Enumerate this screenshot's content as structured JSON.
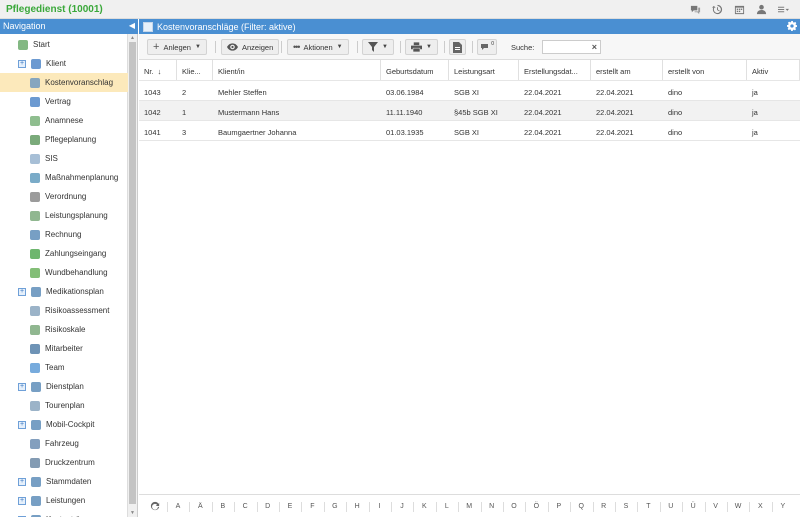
{
  "app": {
    "title": "Pflegedienst (10001)"
  },
  "top_icons": [
    "chat-icon",
    "history-icon",
    "calendar-icon",
    "user-icon",
    "menu-icon"
  ],
  "navigation": {
    "title": "Navigation",
    "items": [
      {
        "label": "Start",
        "icon": "home-icon",
        "expandable": false,
        "indent": 1,
        "selected": false
      },
      {
        "label": "Klient",
        "icon": "client-icon",
        "expandable": true,
        "indent": 1,
        "selected": false
      },
      {
        "label": "Kostenvoranschlag",
        "icon": "estimate-icon",
        "expandable": false,
        "indent": 2,
        "selected": true
      },
      {
        "label": "Vertrag",
        "icon": "contract-icon",
        "expandable": false,
        "indent": 2,
        "selected": false
      },
      {
        "label": "Anamnese",
        "icon": "anamnesis-icon",
        "expandable": false,
        "indent": 2,
        "selected": false
      },
      {
        "label": "Pflegeplanung",
        "icon": "care-plan-icon",
        "expandable": false,
        "indent": 2,
        "selected": false
      },
      {
        "label": "SIS",
        "icon": "sis-icon",
        "expandable": false,
        "indent": 2,
        "selected": false
      },
      {
        "label": "Maßnahmenplanung",
        "icon": "measures-icon",
        "expandable": false,
        "indent": 2,
        "selected": false
      },
      {
        "label": "Verordnung",
        "icon": "prescription-icon",
        "expandable": false,
        "indent": 2,
        "selected": false
      },
      {
        "label": "Leistungsplanung",
        "icon": "service-plan-icon",
        "expandable": false,
        "indent": 2,
        "selected": false
      },
      {
        "label": "Rechnung",
        "icon": "invoice-icon",
        "expandable": false,
        "indent": 2,
        "selected": false
      },
      {
        "label": "Zahlungseingang",
        "icon": "payment-icon",
        "expandable": false,
        "indent": 2,
        "selected": false
      },
      {
        "label": "Wundbehandlung",
        "icon": "wound-icon",
        "expandable": false,
        "indent": 2,
        "selected": false
      },
      {
        "label": "Medikationsplan",
        "icon": "medication-icon",
        "expandable": true,
        "indent": 1,
        "selected": false
      },
      {
        "label": "Risikoassessment",
        "icon": "risk-assessment-icon",
        "expandable": false,
        "indent": 2,
        "selected": false
      },
      {
        "label": "Risikoskale",
        "icon": "risk-scale-icon",
        "expandable": false,
        "indent": 2,
        "selected": false
      },
      {
        "label": "Mitarbeiter",
        "icon": "employee-icon",
        "expandable": false,
        "indent": 2,
        "selected": false
      },
      {
        "label": "Team",
        "icon": "team-icon",
        "expandable": false,
        "indent": 2,
        "selected": false
      },
      {
        "label": "Dienstplan",
        "icon": "duty-roster-icon",
        "expandable": true,
        "indent": 1,
        "selected": false
      },
      {
        "label": "Tourenplan",
        "icon": "route-plan-icon",
        "expandable": false,
        "indent": 2,
        "selected": false
      },
      {
        "label": "Mobil-Cockpit",
        "icon": "cloud-icon",
        "expandable": true,
        "indent": 1,
        "selected": false
      },
      {
        "label": "Fahrzeug",
        "icon": "car-icon",
        "expandable": false,
        "indent": 2,
        "selected": false
      },
      {
        "label": "Druckzentrum",
        "icon": "print-center-icon",
        "expandable": false,
        "indent": 2,
        "selected": false
      },
      {
        "label": "Stammdaten",
        "icon": "master-data-icon",
        "expandable": true,
        "indent": 1,
        "selected": false
      },
      {
        "label": "Leistungen",
        "icon": "services-icon",
        "expandable": true,
        "indent": 1,
        "selected": false
      },
      {
        "label": "Kostenträger",
        "icon": "payer-icon",
        "expandable": true,
        "indent": 1,
        "selected": false
      }
    ]
  },
  "main": {
    "title": "Kostenvoranschläge (Filter: aktive)",
    "toolbar": {
      "anlegen": "Anlegen",
      "anzeigen": "Anzeigen",
      "aktionen": "Aktionen",
      "search_label": "Suche:",
      "search_value": "",
      "messages_count": "0"
    },
    "columns": [
      "Nr.",
      "Klie...",
      "Klient/in",
      "Geburtsdatum",
      "Leistungsart",
      "Erstellungsdat...",
      "erstellt am",
      "erstellt von",
      "Aktiv"
    ],
    "sort_indicator": "↓",
    "rows": [
      [
        "1043",
        "2",
        "Mehler Steffen",
        "03.06.1984",
        "SGB XI",
        "22.04.2021",
        "22.04.2021",
        "dino",
        "ja"
      ],
      [
        "1042",
        "1",
        "Mustermann Hans",
        "11.11.1940",
        "§45b SGB XI",
        "22.04.2021",
        "22.04.2021",
        "dino",
        "ja"
      ],
      [
        "1041",
        "3",
        "Baumgaertner Johanna",
        "01.03.1935",
        "SGB XI",
        "22.04.2021",
        "22.04.2021",
        "dino",
        "ja"
      ]
    ]
  },
  "alphabet": [
    "A",
    "Ä",
    "B",
    "C",
    "D",
    "E",
    "F",
    "G",
    "H",
    "I",
    "J",
    "K",
    "L",
    "M",
    "N",
    "O",
    "Ö",
    "P",
    "Q",
    "R",
    "S",
    "T",
    "U",
    "Ü",
    "V",
    "W",
    "X",
    "Y"
  ],
  "colors": {
    "accent": "#4a8fd2",
    "brand": "#3aa83a",
    "selected": "#fce9bb"
  }
}
